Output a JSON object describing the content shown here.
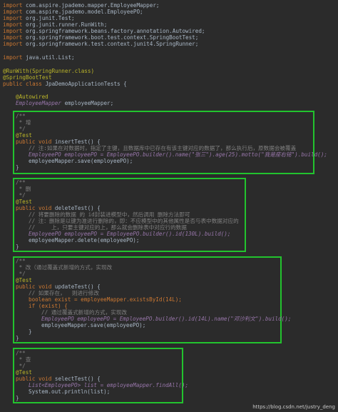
{
  "imports": [
    "com.aspire.jpademo.mapper.EmployeeMapper;",
    "com.aspire.jpademo.model.EmployeePO;",
    "org.junit.Test;",
    "org.junit.runner.RunWith;",
    "org.springframework.beans.factory.annotation.Autowired;",
    "org.springframework.boot.test.context.SpringBootTest;",
    "org.springframework.test.context.junit4.SpringRunner;"
  ],
  "import_kw": "import",
  "util_import": "java.util.List;",
  "runwith": "@RunWith(SpringRunner.class)",
  "springboottest": "@SpringBootTest",
  "class_decl": {
    "kw": "public class",
    "name": " JpaDemoApplicationTests {"
  },
  "autowired": "@Autowired",
  "field_decl": {
    "type": "EmployeeMapper",
    "name": " employeeMapper;"
  },
  "block_insert": {
    "open": "/**",
    "doc": " * 增",
    "close": " */",
    "test": "@Test",
    "sig_kw": "public void",
    "sig": " insertTest() {",
    "comment": "// 注:如果在对数据时，指定了主键，且数据库中已存在有该主键对应的数据了，那么执行后，原数据会被覆盖",
    "stmt1": "EmployeePO employeePO = EmployeePO.builder().name(\"张三\").age(25).motto(\"我是座右铭\").build();",
    "stmt2": "employeeMapper.save(employeePO);",
    "close_brace": "}"
  },
  "block_delete": {
    "open": "/**",
    "doc": " * 删",
    "close": " */",
    "test": "@Test",
    "sig_kw": "public void",
    "sig": " deleteTest() {",
    "c1": "// 将要删除的数据 的 id封装进模型中，然后调用 删除方法即可",
    "c2": "// 注：删除是以键为准进行删除的，即：不应模型中的其他属性是否与表中数据对应的",
    "c3": "//     上，只要主键对应的上，那么就会删除表中对应行的数据",
    "stmt1": "EmployeePO employeePO = EmployeePO.builder().id(130L).build();",
    "stmt2": "employeeMapper.delete(employeePO);",
    "close_brace": "}"
  },
  "block_update": {
    "open": "/**",
    "doc": " * 改（通过覆盖式新增的方式，实现改",
    "close": " */",
    "test": "@Test",
    "sig_kw": "public void",
    "sig": " updateTest() {",
    "c1": "// 如果存在，  则进行修改",
    "stmt1": "boolean exist = employeeMapper.existsById(14L);",
    "if_line": "if (exist) {",
    "c2": "// 通过覆盖式新增的方式，实现改",
    "stmt2": "EmployeePO employeePO = EmployeePO.builder().id(14L).name(\"邓沙利文\").build();",
    "stmt3": "employeeMapper.save(employeePO);",
    "inner_close": "}",
    "close_brace": "}"
  },
  "block_select": {
    "open": "/**",
    "doc": " * 查",
    "close": " */",
    "test": "@Test",
    "sig_kw": "public void",
    "sig": " selectTest() {",
    "stmt1": "List<EmployeePO> list = employeeMapper.findAll();",
    "stmt2": "System.out.println(list);",
    "close_brace": "}"
  },
  "watermark": "https://blog.csdn.net/justry_deng",
  "colors": {
    "highlight_box": "#22c32e",
    "background": "#2b2b2b",
    "keyword": "#cc7832",
    "annotation": "#bbb529",
    "string": "#6a8759",
    "number": "#6897bb"
  }
}
